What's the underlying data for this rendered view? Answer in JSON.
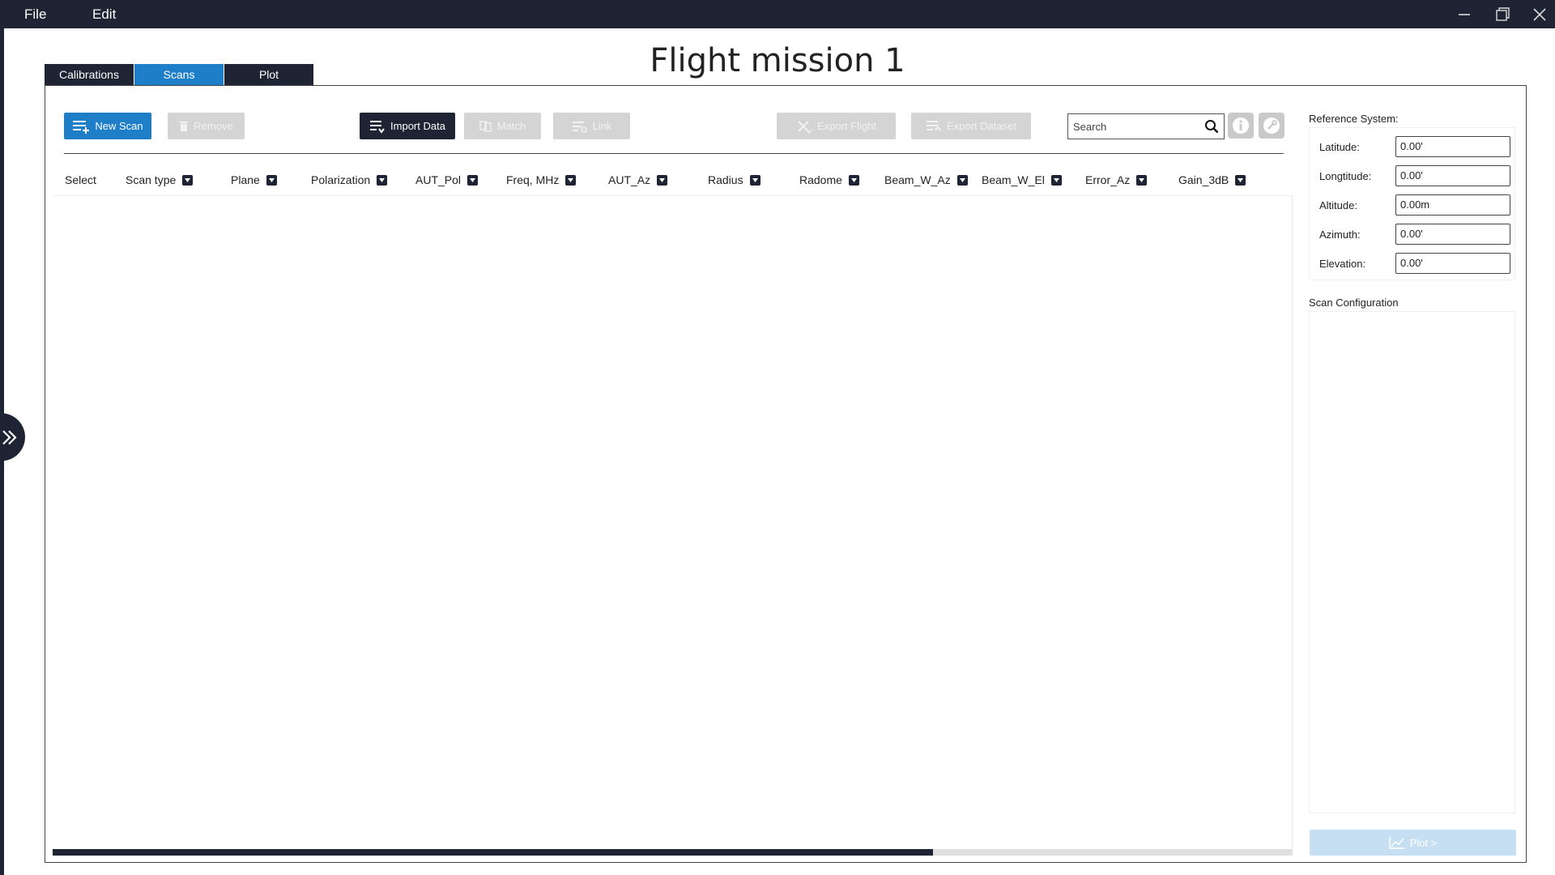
{
  "menu": {
    "file": "File",
    "edit": "Edit"
  },
  "page_title": "Flight mission 1",
  "tabs": [
    {
      "label": "Calibrations",
      "active": false
    },
    {
      "label": "Scans",
      "active": true
    },
    {
      "label": "Plot",
      "active": false
    }
  ],
  "toolbar": {
    "new_scan": "New Scan",
    "remove": "Remove",
    "import_data": "Import Data",
    "match": "Match",
    "link": "Link",
    "export_flight": "Export Flight",
    "export_dataset": "Export Dataset",
    "search_placeholder": "Search"
  },
  "table": {
    "columns": [
      "Select",
      "Scan type",
      "Plane",
      "Polarization",
      "AUT_Pol",
      "Freq, MHz",
      "AUT_Az",
      "Radius",
      "Radome",
      "Beam_W_Az",
      "Beam_W_El",
      "Error_Az",
      "Gain_3dB"
    ],
    "rows": [],
    "horizontal_scroll_fraction": 0.71
  },
  "reference_system": {
    "heading": "Reference System:",
    "fields": [
      {
        "label": "Latitude:",
        "value": "0.00'"
      },
      {
        "label": "Longtitude:",
        "value": "0.00'"
      },
      {
        "label": "Altitude:",
        "value": "0.00m"
      },
      {
        "label": "Azimuth:",
        "value": "0.00'"
      },
      {
        "label": "Elevation:",
        "value": "0.00'"
      }
    ]
  },
  "scan_configuration": {
    "heading": "Scan Configuration"
  },
  "plot_button": "Plot >",
  "colors": {
    "dark": "#1e2433",
    "accent": "#1f7ec8",
    "disabled": "#d4d4d4",
    "plot_disabled": "#c7dff3"
  },
  "icons": {
    "menu_bar": [
      "minimize-icon",
      "maximize-icon",
      "close-icon"
    ],
    "side": "double-chevron-right-icon",
    "search": "search-icon",
    "info": "info-icon",
    "settings": "wrench-icon",
    "sort": "caret-down-icon"
  }
}
